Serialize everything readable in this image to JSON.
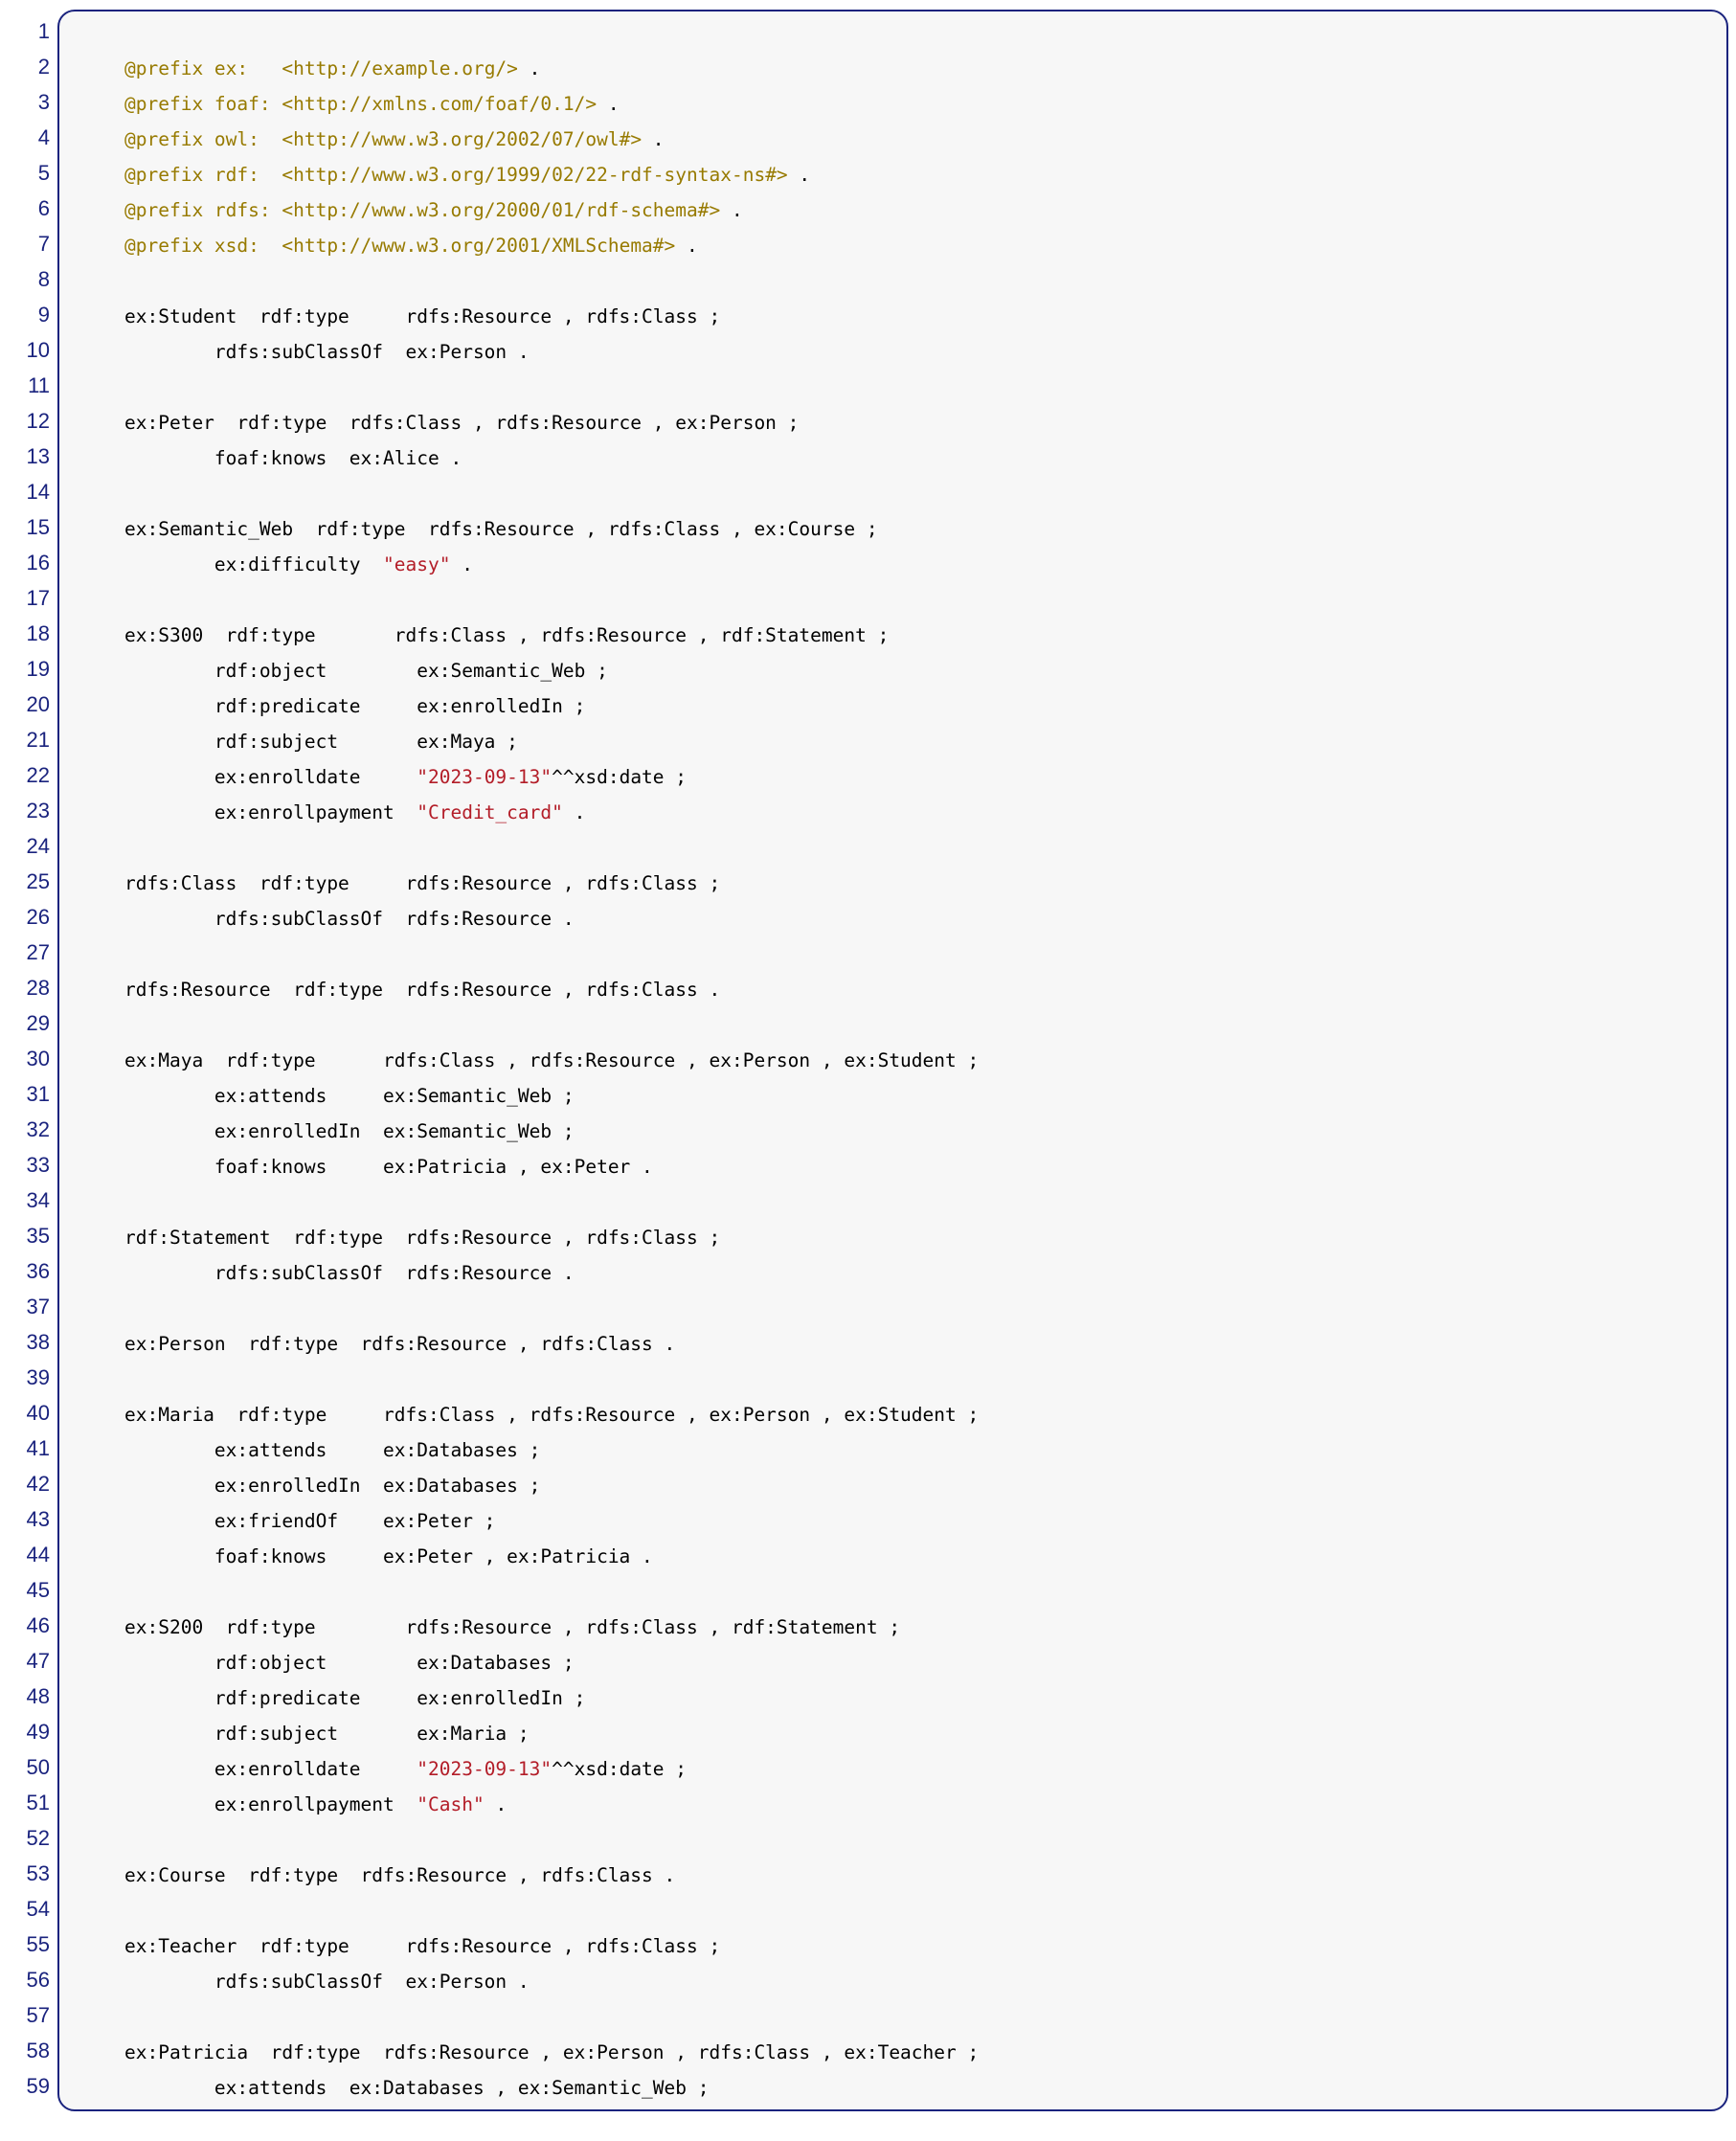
{
  "lines": [
    {
      "n": "1",
      "segs": []
    },
    {
      "n": "2",
      "segs": [
        {
          "c": "kw",
          "t": "@prefix ex:   "
        },
        {
          "c": "uri",
          "t": "<http://example.org/>"
        },
        {
          "c": "pun",
          "t": " ."
        }
      ]
    },
    {
      "n": "3",
      "segs": [
        {
          "c": "kw",
          "t": "@prefix foaf: "
        },
        {
          "c": "uri",
          "t": "<http://xmlns.com/foaf/0.1/>"
        },
        {
          "c": "pun",
          "t": " ."
        }
      ]
    },
    {
      "n": "4",
      "segs": [
        {
          "c": "kw",
          "t": "@prefix owl:  "
        },
        {
          "c": "uri",
          "t": "<http://www.w3.org/2002/07/owl#>"
        },
        {
          "c": "pun",
          "t": " ."
        }
      ]
    },
    {
      "n": "5",
      "segs": [
        {
          "c": "kw",
          "t": "@prefix rdf:  "
        },
        {
          "c": "uri",
          "t": "<http://www.w3.org/1999/02/22-rdf-syntax-ns#>"
        },
        {
          "c": "pun",
          "t": " ."
        }
      ]
    },
    {
      "n": "6",
      "segs": [
        {
          "c": "kw",
          "t": "@prefix rdfs: "
        },
        {
          "c": "uri",
          "t": "<http://www.w3.org/2000/01/rdf-schema#>"
        },
        {
          "c": "pun",
          "t": " ."
        }
      ]
    },
    {
      "n": "7",
      "segs": [
        {
          "c": "kw",
          "t": "@prefix xsd:  "
        },
        {
          "c": "uri",
          "t": "<http://www.w3.org/2001/XMLSchema#>"
        },
        {
          "c": "pun",
          "t": " ."
        }
      ]
    },
    {
      "n": "8",
      "segs": []
    },
    {
      "n": "9",
      "segs": [
        {
          "c": "pun",
          "t": "ex:Student  rdf:type     rdfs:Resource , rdfs:Class ;"
        }
      ]
    },
    {
      "n": "10",
      "segs": [
        {
          "c": "pun",
          "t": "        rdfs:subClassOf  ex:Person ."
        }
      ]
    },
    {
      "n": "11",
      "segs": []
    },
    {
      "n": "12",
      "segs": [
        {
          "c": "pun",
          "t": "ex:Peter  rdf:type  rdfs:Class , rdfs:Resource , ex:Person ;"
        }
      ]
    },
    {
      "n": "13",
      "segs": [
        {
          "c": "pun",
          "t": "        foaf:knows  ex:Alice ."
        }
      ]
    },
    {
      "n": "14",
      "segs": []
    },
    {
      "n": "15",
      "segs": [
        {
          "c": "pun",
          "t": "ex:Semantic_Web  rdf:type  rdfs:Resource , rdfs:Class , ex:Course ;"
        }
      ]
    },
    {
      "n": "16",
      "segs": [
        {
          "c": "pun",
          "t": "        ex:difficulty  "
        },
        {
          "c": "str",
          "t": "\"easy\""
        },
        {
          "c": "pun",
          "t": " ."
        }
      ]
    },
    {
      "n": "17",
      "segs": []
    },
    {
      "n": "18",
      "segs": [
        {
          "c": "pun",
          "t": "ex:S300  rdf:type       rdfs:Class , rdfs:Resource , rdf:Statement ;"
        }
      ]
    },
    {
      "n": "19",
      "segs": [
        {
          "c": "pun",
          "t": "        rdf:object        ex:Semantic_Web ;"
        }
      ]
    },
    {
      "n": "20",
      "segs": [
        {
          "c": "pun",
          "t": "        rdf:predicate     ex:enrolledIn ;"
        }
      ]
    },
    {
      "n": "21",
      "segs": [
        {
          "c": "pun",
          "t": "        rdf:subject       ex:Maya ;"
        }
      ]
    },
    {
      "n": "22",
      "segs": [
        {
          "c": "pun",
          "t": "        ex:enrolldate     "
        },
        {
          "c": "str",
          "t": "\"2023-09-13\""
        },
        {
          "c": "pun",
          "t": "^^xsd:date ;"
        }
      ]
    },
    {
      "n": "23",
      "segs": [
        {
          "c": "pun",
          "t": "        ex:enrollpayment  "
        },
        {
          "c": "str",
          "t": "\"Credit_card\""
        },
        {
          "c": "pun",
          "t": " ."
        }
      ]
    },
    {
      "n": "24",
      "segs": []
    },
    {
      "n": "25",
      "segs": [
        {
          "c": "pun",
          "t": "rdfs:Class  rdf:type     rdfs:Resource , rdfs:Class ;"
        }
      ]
    },
    {
      "n": "26",
      "segs": [
        {
          "c": "pun",
          "t": "        rdfs:subClassOf  rdfs:Resource ."
        }
      ]
    },
    {
      "n": "27",
      "segs": []
    },
    {
      "n": "28",
      "segs": [
        {
          "c": "pun",
          "t": "rdfs:Resource  rdf:type  rdfs:Resource , rdfs:Class ."
        }
      ]
    },
    {
      "n": "29",
      "segs": []
    },
    {
      "n": "30",
      "segs": [
        {
          "c": "pun",
          "t": "ex:Maya  rdf:type      rdfs:Class , rdfs:Resource , ex:Person , ex:Student ;"
        }
      ]
    },
    {
      "n": "31",
      "segs": [
        {
          "c": "pun",
          "t": "        ex:attends     ex:Semantic_Web ;"
        }
      ]
    },
    {
      "n": "32",
      "segs": [
        {
          "c": "pun",
          "t": "        ex:enrolledIn  ex:Semantic_Web ;"
        }
      ]
    },
    {
      "n": "33",
      "segs": [
        {
          "c": "pun",
          "t": "        foaf:knows     ex:Patricia , ex:Peter ."
        }
      ]
    },
    {
      "n": "34",
      "segs": []
    },
    {
      "n": "35",
      "segs": [
        {
          "c": "pun",
          "t": "rdf:Statement  rdf:type  rdfs:Resource , rdfs:Class ;"
        }
      ]
    },
    {
      "n": "36",
      "segs": [
        {
          "c": "pun",
          "t": "        rdfs:subClassOf  rdfs:Resource ."
        }
      ]
    },
    {
      "n": "37",
      "segs": []
    },
    {
      "n": "38",
      "segs": [
        {
          "c": "pun",
          "t": "ex:Person  rdf:type  rdfs:Resource , rdfs:Class ."
        }
      ]
    },
    {
      "n": "39",
      "segs": []
    },
    {
      "n": "40",
      "segs": [
        {
          "c": "pun",
          "t": "ex:Maria  rdf:type     rdfs:Class , rdfs:Resource , ex:Person , ex:Student ;"
        }
      ]
    },
    {
      "n": "41",
      "segs": [
        {
          "c": "pun",
          "t": "        ex:attends     ex:Databases ;"
        }
      ]
    },
    {
      "n": "42",
      "segs": [
        {
          "c": "pun",
          "t": "        ex:enrolledIn  ex:Databases ;"
        }
      ]
    },
    {
      "n": "43",
      "segs": [
        {
          "c": "pun",
          "t": "        ex:friendOf    ex:Peter ;"
        }
      ]
    },
    {
      "n": "44",
      "segs": [
        {
          "c": "pun",
          "t": "        foaf:knows     ex:Peter , ex:Patricia ."
        }
      ]
    },
    {
      "n": "45",
      "segs": []
    },
    {
      "n": "46",
      "segs": [
        {
          "c": "pun",
          "t": "ex:S200  rdf:type        rdfs:Resource , rdfs:Class , rdf:Statement ;"
        }
      ]
    },
    {
      "n": "47",
      "segs": [
        {
          "c": "pun",
          "t": "        rdf:object        ex:Databases ;"
        }
      ]
    },
    {
      "n": "48",
      "segs": [
        {
          "c": "pun",
          "t": "        rdf:predicate     ex:enrolledIn ;"
        }
      ]
    },
    {
      "n": "49",
      "segs": [
        {
          "c": "pun",
          "t": "        rdf:subject       ex:Maria ;"
        }
      ]
    },
    {
      "n": "50",
      "segs": [
        {
          "c": "pun",
          "t": "        ex:enrolldate     "
        },
        {
          "c": "str",
          "t": "\"2023-09-13\""
        },
        {
          "c": "pun",
          "t": "^^xsd:date ;"
        }
      ]
    },
    {
      "n": "51",
      "segs": [
        {
          "c": "pun",
          "t": "        ex:enrollpayment  "
        },
        {
          "c": "str",
          "t": "\"Cash\""
        },
        {
          "c": "pun",
          "t": " ."
        }
      ]
    },
    {
      "n": "52",
      "segs": []
    },
    {
      "n": "53",
      "segs": [
        {
          "c": "pun",
          "t": "ex:Course  rdf:type  rdfs:Resource , rdfs:Class ."
        }
      ]
    },
    {
      "n": "54",
      "segs": []
    },
    {
      "n": "55",
      "segs": [
        {
          "c": "pun",
          "t": "ex:Teacher  rdf:type     rdfs:Resource , rdfs:Class ;"
        }
      ]
    },
    {
      "n": "56",
      "segs": [
        {
          "c": "pun",
          "t": "        rdfs:subClassOf  ex:Person ."
        }
      ]
    },
    {
      "n": "57",
      "segs": []
    },
    {
      "n": "58",
      "segs": [
        {
          "c": "pun",
          "t": "ex:Patricia  rdf:type  rdfs:Resource , ex:Person , rdfs:Class , ex:Teacher ;"
        }
      ]
    },
    {
      "n": "59",
      "segs": [
        {
          "c": "pun",
          "t": "        ex:attends  ex:Databases , ex:Semantic_Web ;"
        }
      ]
    }
  ]
}
